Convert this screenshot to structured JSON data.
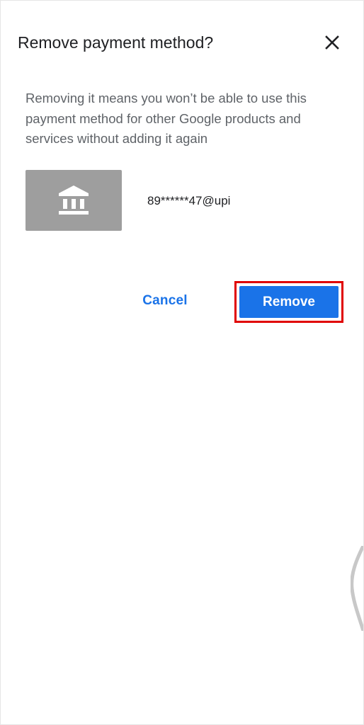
{
  "dialog": {
    "title": "Remove payment method?",
    "close_icon": "close-icon",
    "description": "Removing it means you won’t be able to use this payment method for other Google products and services without adding it again",
    "payment_method": {
      "icon": "bank-icon",
      "label": "89******47@upi"
    },
    "actions": {
      "cancel_label": "Cancel",
      "remove_label": "Remove"
    },
    "colors": {
      "accent": "#1a73e8",
      "highlight_border": "#e00000",
      "bank_tile": "#9e9e9e"
    }
  }
}
